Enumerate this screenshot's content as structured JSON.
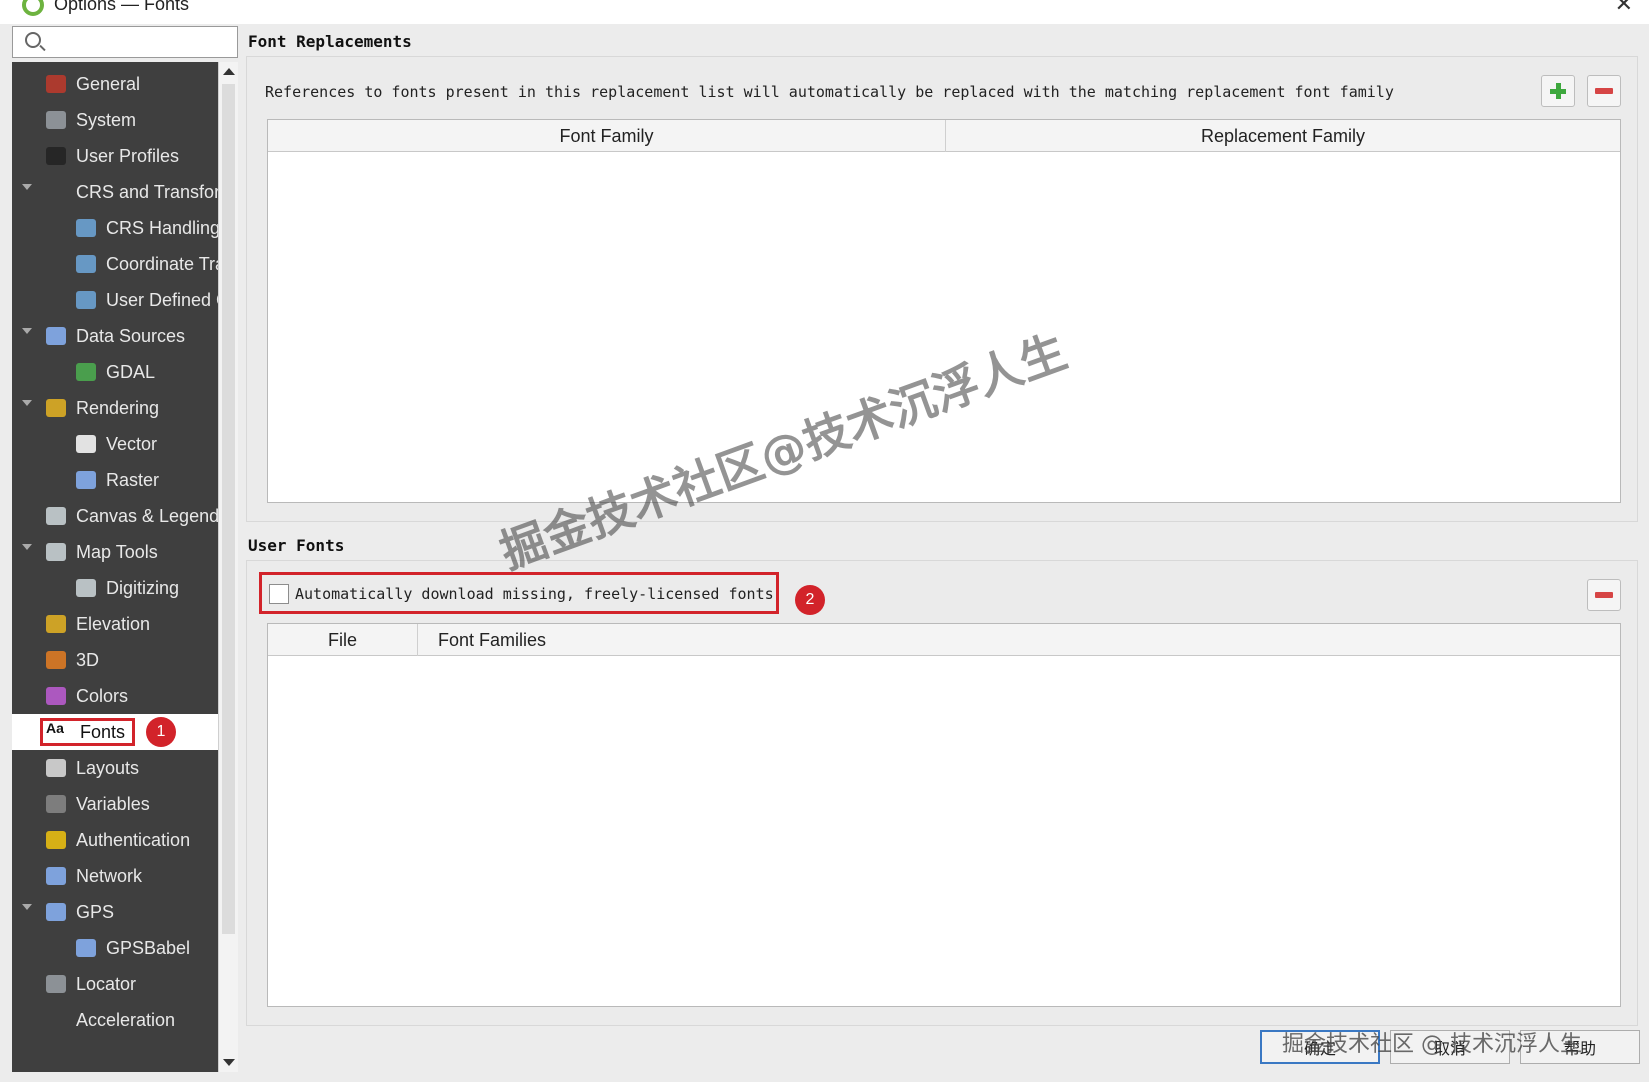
{
  "window": {
    "title": "Options — Fonts"
  },
  "search": {
    "placeholder": ""
  },
  "sidebar": {
    "items": [
      {
        "label": "General",
        "icon": "tools-icon",
        "color": "#c0392b",
        "indent": 0,
        "expander": false
      },
      {
        "label": "System",
        "icon": "gear-icon",
        "color": "#9aa0a6",
        "indent": 0,
        "expander": false
      },
      {
        "label": "User Profiles",
        "icon": "user-icon",
        "color": "#222222",
        "indent": 0,
        "expander": false
      },
      {
        "label": "CRS and Transforms",
        "icon": "none",
        "color": "",
        "indent": 0,
        "expander": true
      },
      {
        "label": "CRS Handling",
        "icon": "globe-icon",
        "color": "#6fa8dc",
        "indent": 1,
        "expander": false
      },
      {
        "label": "Coordinate Transforms",
        "icon": "globe-arrows-icon",
        "color": "#6fa8dc",
        "indent": 1,
        "expander": false
      },
      {
        "label": "User Defined CRS",
        "icon": "globe-user-icon",
        "color": "#6fa8dc",
        "indent": 1,
        "expander": false
      },
      {
        "label": "Data Sources",
        "icon": "table-icon",
        "color": "#8ab4f8",
        "indent": 0,
        "expander": true
      },
      {
        "label": "GDAL",
        "icon": "gdal-icon",
        "color": "#4caf50",
        "indent": 1,
        "expander": false
      },
      {
        "label": "Rendering",
        "icon": "brush-icon",
        "color": "#e6b422",
        "indent": 0,
        "expander": true
      },
      {
        "label": "Vector",
        "icon": "vector-icon",
        "color": "#ffffff",
        "indent": 1,
        "expander": false
      },
      {
        "label": "Raster",
        "icon": "raster-icon",
        "color": "#8ab4f8",
        "indent": 1,
        "expander": false
      },
      {
        "label": "Canvas & Legend",
        "icon": "canvas-icon",
        "color": "#cfd8dc",
        "indent": 0,
        "expander": false
      },
      {
        "label": "Map Tools",
        "icon": "map-tools-icon",
        "color": "#cfd8dc",
        "indent": 0,
        "expander": true
      },
      {
        "label": "Digitizing",
        "icon": "digitizing-icon",
        "color": "#cfd8dc",
        "indent": 1,
        "expander": false
      },
      {
        "label": "Elevation",
        "icon": "elevation-icon",
        "color": "#e6b422",
        "indent": 0,
        "expander": false
      },
      {
        "label": "3D",
        "icon": "cube-icon",
        "color": "#e67e22",
        "indent": 0,
        "expander": false
      },
      {
        "label": "Colors",
        "icon": "palette-icon",
        "color": "#c05dd6",
        "indent": 0,
        "expander": false
      },
      {
        "label": "Fonts",
        "icon": "font-icon",
        "color": "#111111",
        "indent": 0,
        "expander": false,
        "selected": true
      },
      {
        "label": "Layouts",
        "icon": "layout-icon",
        "color": "#e0e0e0",
        "indent": 0,
        "expander": false
      },
      {
        "label": "Variables",
        "icon": "variables-icon",
        "color": "#888888",
        "indent": 0,
        "expander": false
      },
      {
        "label": "Authentication",
        "icon": "lock-icon",
        "color": "#f1c40f",
        "indent": 0,
        "expander": false
      },
      {
        "label": "Network",
        "icon": "network-icon",
        "color": "#8ab4f8",
        "indent": 0,
        "expander": false
      },
      {
        "label": "GPS",
        "icon": "gps-icon",
        "color": "#8ab4f8",
        "indent": 0,
        "expander": true
      },
      {
        "label": "GPSBabel",
        "icon": "gps-icon",
        "color": "#8ab4f8",
        "indent": 1,
        "expander": false
      },
      {
        "label": "Locator",
        "icon": "search-icon",
        "color": "#9aa0a6",
        "indent": 0,
        "expander": false
      },
      {
        "label": "Acceleration",
        "icon": "none",
        "color": "",
        "indent": 0,
        "expander": false
      }
    ]
  },
  "font_replacements": {
    "title": "Font Replacements",
    "description": "References to fonts present in this replacement list will automatically be replaced with the matching replacement font family",
    "columns": [
      "Font Family",
      "Replacement Family"
    ]
  },
  "user_fonts": {
    "title": "User Fonts",
    "checkbox_label": "Automatically download missing, freely-licensed fonts",
    "checkbox_checked": false,
    "columns": [
      "File",
      "Font Families"
    ]
  },
  "annotations": {
    "badge_1": "1",
    "badge_2": "2"
  },
  "buttons": {
    "ok": "确定",
    "cancel": "取消",
    "help": "帮助"
  },
  "watermark": {
    "main": "掘金技术社区@技术沉浮人生",
    "corner": "掘金技术社区 @ 技术沉浮人生"
  },
  "colors": {
    "sidebar_bg": "#3f3f3f",
    "highlight": "#d2232a",
    "add": "#3ea83e",
    "remove": "#d64545"
  }
}
